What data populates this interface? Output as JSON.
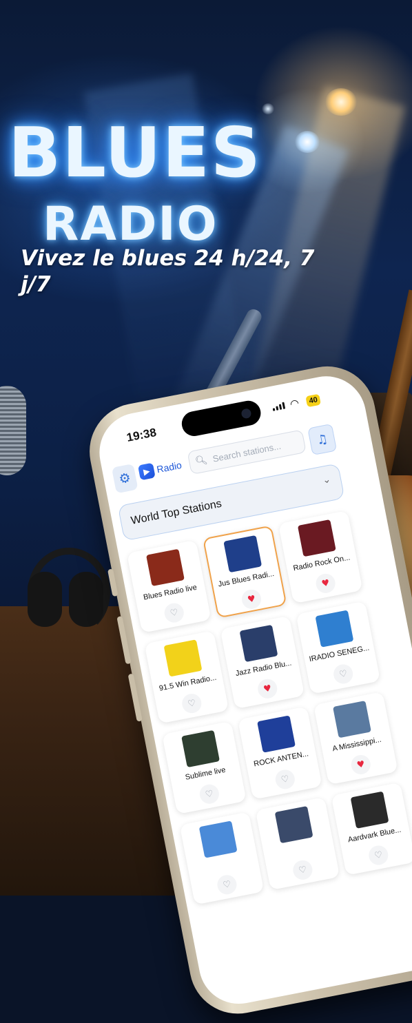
{
  "promo": {
    "logo_line1": "BLUES",
    "logo_line2": "RADIO",
    "tagline": "Vivez le blues 24 h/24, 7 j/7"
  },
  "status_bar": {
    "time": "19:38",
    "battery": "40"
  },
  "toolbar": {
    "app_name": "Radio",
    "search_placeholder": "Search stations..."
  },
  "category_dropdown": {
    "selected": "World Top Stations"
  },
  "stations": [
    {
      "name": "Blues Radio live",
      "favorite": false,
      "selected": false,
      "art_color": "#8a2a1a"
    },
    {
      "name": "Jus Blues Radi...",
      "favorite": true,
      "selected": true,
      "art_color": "#1f3f8a"
    },
    {
      "name": "Radio Rock On...",
      "favorite": true,
      "selected": false,
      "art_color": "#6a1a22"
    },
    {
      "name": "91.5 Win Radio...",
      "favorite": false,
      "selected": false,
      "art_color": "#f2d21a"
    },
    {
      "name": "Jazz Radio Blu...",
      "favorite": true,
      "selected": false,
      "art_color": "#2a3e6a"
    },
    {
      "name": "IRADIO SENEG...",
      "favorite": false,
      "selected": false,
      "art_color": "#2f7fd0"
    },
    {
      "name": "Sublime live",
      "favorite": false,
      "selected": false,
      "art_color": "#2e3e30"
    },
    {
      "name": "ROCK ANTEN...",
      "favorite": false,
      "selected": false,
      "art_color": "#1f3f9a"
    },
    {
      "name": "A Mississippi...",
      "favorite": true,
      "selected": false,
      "art_color": "#5a7aa0"
    },
    {
      "name": "",
      "favorite": false,
      "selected": false,
      "art_color": "#4a8ad8"
    },
    {
      "name": "",
      "favorite": false,
      "selected": false,
      "art_color": "#3a4a6a"
    },
    {
      "name": "Aardvark Blue...",
      "favorite": false,
      "selected": false,
      "art_color": "#2a2a2a"
    }
  ]
}
